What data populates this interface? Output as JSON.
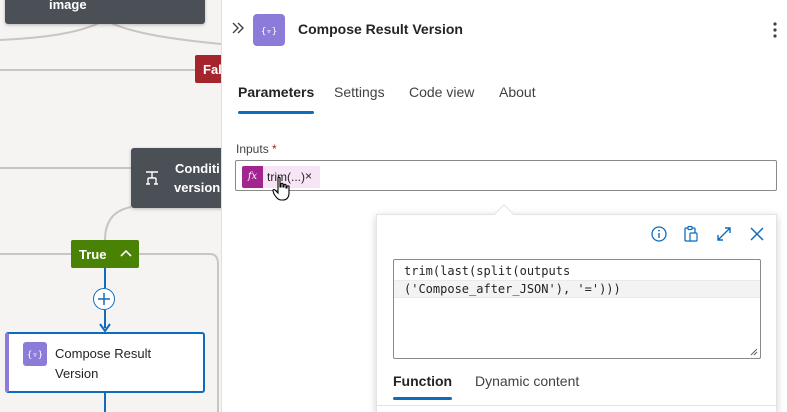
{
  "canvas": {
    "image_node": {
      "label": "image"
    },
    "false_badge": {
      "label": "Fal"
    },
    "condition_node": {
      "line1": "Conditi",
      "line2": "version"
    },
    "true_badge": {
      "label": "True"
    },
    "compose_node": {
      "line1": "Compose Result",
      "line2": "Version"
    }
  },
  "panel": {
    "title": "Compose Result Version",
    "tabs": [
      {
        "label": "Parameters",
        "selected": true
      },
      {
        "label": "Settings",
        "selected": false
      },
      {
        "label": "Code view",
        "selected": false
      },
      {
        "label": "About",
        "selected": false
      }
    ],
    "inputs": {
      "label": "Inputs",
      "required_mark": "*",
      "token": {
        "fx": "fx",
        "label": "trim(...)",
        "remove": "×"
      }
    }
  },
  "expression_editor": {
    "line1": "trim(last(split(outputs",
    "line2": "('Compose_after_JSON'), '=')))",
    "tabs": [
      {
        "label": "Function",
        "selected": true
      },
      {
        "label": "Dynamic content",
        "selected": false
      }
    ],
    "icons": [
      "info-icon",
      "paste-icon",
      "expand-icon",
      "close-icon"
    ]
  },
  "colors": {
    "accent": "#0f6cbd",
    "compose_purple": "#8c7bd9",
    "true_green": "#498205",
    "false_red": "#a4262c",
    "fx_magenta": "#a3248e",
    "node_dark": "#4b5057"
  }
}
